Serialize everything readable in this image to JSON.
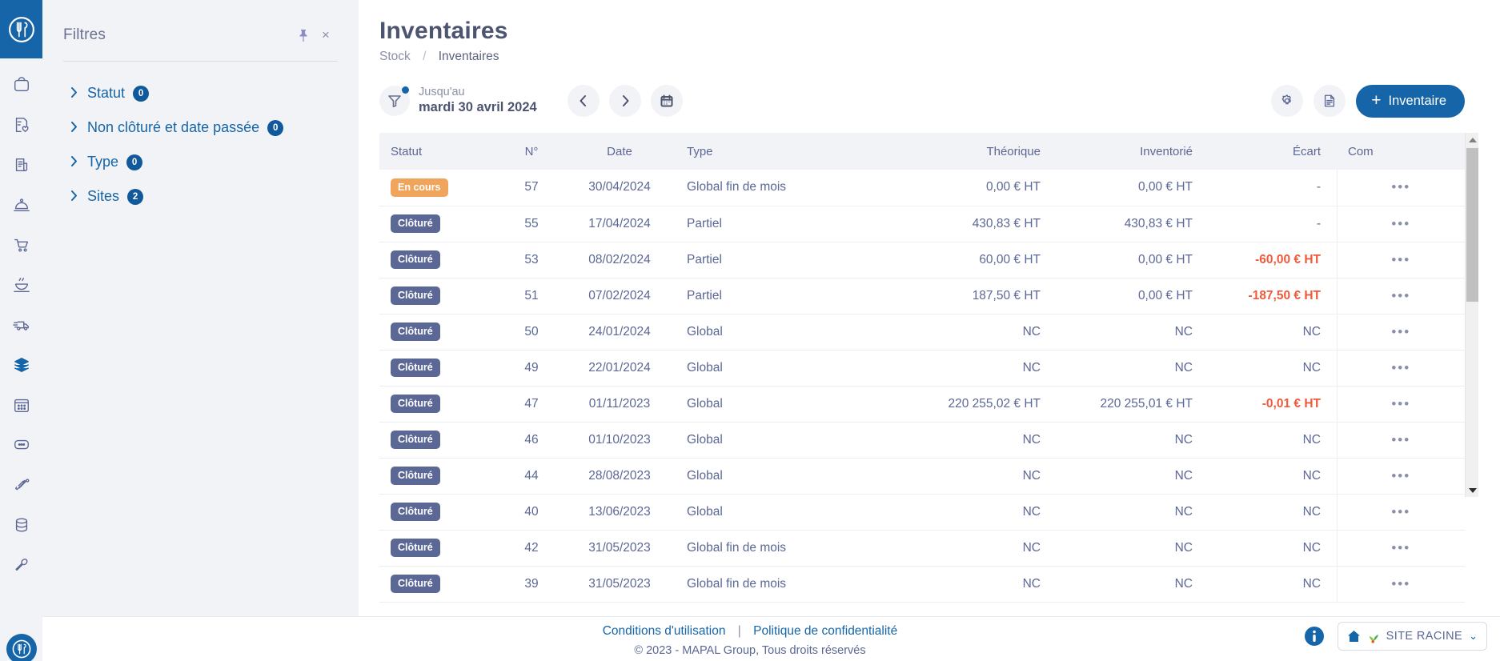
{
  "rail": {
    "logo_name": "mapal-logo",
    "icons": [
      {
        "name": "basket-icon"
      },
      {
        "name": "checklist-heart-icon"
      },
      {
        "name": "document-icon"
      },
      {
        "name": "cloche-icon"
      },
      {
        "name": "shopping-cart-icon"
      },
      {
        "name": "cooking-pot-icon"
      },
      {
        "name": "delivery-truck-icon"
      },
      {
        "name": "stock-layers-icon"
      },
      {
        "name": "calendar-grid-icon"
      },
      {
        "name": "chat-bubble-icon"
      },
      {
        "name": "fish-bone-icon"
      },
      {
        "name": "database-icon"
      },
      {
        "name": "wrench-icon"
      }
    ]
  },
  "filters": {
    "title": "Filtres",
    "pin_label": "Épingler",
    "close_label": "×",
    "items": [
      {
        "label": "Statut",
        "count": "0"
      },
      {
        "label": "Non clôturé et date passée",
        "count": "0"
      },
      {
        "label": "Type",
        "count": "0"
      },
      {
        "label": "Sites",
        "count": "2"
      }
    ]
  },
  "header": {
    "title": "Inventaires",
    "breadcrumb_root": "Stock",
    "breadcrumb_sep": "/",
    "breadcrumb_current": "Inventaires"
  },
  "toolbar": {
    "date_filter_label": "Jusqu'au",
    "date_filter_value": "mardi 30 avril 2024",
    "prev_label": "Précédent",
    "next_label": "Suivant",
    "calendar_label": "Calendrier",
    "settings_label": "Paramètres",
    "export_label": "Exporter",
    "add_plus": "+",
    "add_label": "Inventaire"
  },
  "table": {
    "columns": [
      "Statut",
      "N°",
      "Date",
      "Type",
      "Théorique",
      "Inventorié",
      "Écart",
      "Com"
    ],
    "row_menu_glyph": "•••",
    "rows": [
      {
        "statut": "En cours",
        "statut_kind": "encours",
        "num": "57",
        "date": "30/04/2024",
        "type": "Global fin de mois",
        "theorique": "0,00 € HT",
        "inventorie": "0,00 € HT",
        "ecart": "-",
        "ecart_neg": false
      },
      {
        "statut": "Clôturé",
        "statut_kind": "cloture",
        "num": "55",
        "date": "17/04/2024",
        "type": "Partiel",
        "theorique": "430,83 € HT",
        "inventorie": "430,83 € HT",
        "ecart": "-",
        "ecart_neg": false
      },
      {
        "statut": "Clôturé",
        "statut_kind": "cloture",
        "num": "53",
        "date": "08/02/2024",
        "type": "Partiel",
        "theorique": "60,00 € HT",
        "inventorie": "0,00 € HT",
        "ecart": "-60,00 € HT",
        "ecart_neg": true
      },
      {
        "statut": "Clôturé",
        "statut_kind": "cloture",
        "num": "51",
        "date": "07/02/2024",
        "type": "Partiel",
        "theorique": "187,50 € HT",
        "inventorie": "0,00 € HT",
        "ecart": "-187,50 € HT",
        "ecart_neg": true
      },
      {
        "statut": "Clôturé",
        "statut_kind": "cloture",
        "num": "50",
        "date": "24/01/2024",
        "type": "Global",
        "theorique": "NC",
        "inventorie": "NC",
        "ecart": "NC",
        "ecart_neg": false
      },
      {
        "statut": "Clôturé",
        "statut_kind": "cloture",
        "num": "49",
        "date": "22/01/2024",
        "type": "Global",
        "theorique": "NC",
        "inventorie": "NC",
        "ecart": "NC",
        "ecart_neg": false
      },
      {
        "statut": "Clôturé",
        "statut_kind": "cloture",
        "num": "47",
        "date": "01/11/2023",
        "type": "Global",
        "theorique": "220 255,02 € HT",
        "inventorie": "220 255,01 € HT",
        "ecart": "-0,01 € HT",
        "ecart_neg": true
      },
      {
        "statut": "Clôturé",
        "statut_kind": "cloture",
        "num": "46",
        "date": "01/10/2023",
        "type": "Global",
        "theorique": "NC",
        "inventorie": "NC",
        "ecart": "NC",
        "ecart_neg": false
      },
      {
        "statut": "Clôturé",
        "statut_kind": "cloture",
        "num": "44",
        "date": "28/08/2023",
        "type": "Global",
        "theorique": "NC",
        "inventorie": "NC",
        "ecart": "NC",
        "ecart_neg": false
      },
      {
        "statut": "Clôturé",
        "statut_kind": "cloture",
        "num": "40",
        "date": "13/06/2023",
        "type": "Global",
        "theorique": "NC",
        "inventorie": "NC",
        "ecart": "NC",
        "ecart_neg": false
      },
      {
        "statut": "Clôturé",
        "statut_kind": "cloture",
        "num": "42",
        "date": "31/05/2023",
        "type": "Global fin de mois",
        "theorique": "NC",
        "inventorie": "NC",
        "ecart": "NC",
        "ecart_neg": false
      },
      {
        "statut": "Clôturé",
        "statut_kind": "cloture",
        "num": "39",
        "date": "31/05/2023",
        "type": "Global fin de mois",
        "theorique": "NC",
        "inventorie": "NC",
        "ecart": "NC",
        "ecart_neg": false
      }
    ]
  },
  "footer": {
    "terms": "Conditions d'utilisation",
    "separator": "|",
    "privacy": "Politique de confidentialité",
    "copyright": "© 2023 - MAPAL Group, Tous droits réservés",
    "site_label": "SITE RACINE",
    "chevron": "⌄"
  },
  "colors": {
    "brand_blue": "#1565a8",
    "slate": "#5b6795",
    "orange": "#f0a45c",
    "negative_red": "#f0593c",
    "panel_grey": "#f2f3f6"
  }
}
